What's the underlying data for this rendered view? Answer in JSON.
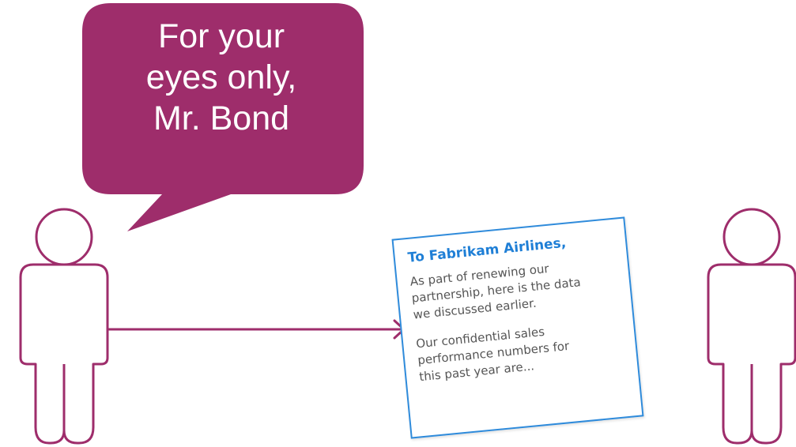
{
  "speech_bubble": {
    "lines": [
      "For your",
      "eyes only,",
      "Mr. Bond"
    ],
    "color": "#9e2d6b"
  },
  "figure_color": "#9e2d6b",
  "letter": {
    "heading": "To Fabrikam Airlines,",
    "paragraph1": [
      "As part of renewing our",
      "partnership, here is the data",
      "we discussed earlier."
    ],
    "paragraph2": [
      "Our confidential sales",
      "performance numbers for",
      "this past year are..."
    ],
    "border_color": "#2f8bdb",
    "heading_color": "#1f7fd6"
  },
  "arrow_color": "#9e2d6b"
}
